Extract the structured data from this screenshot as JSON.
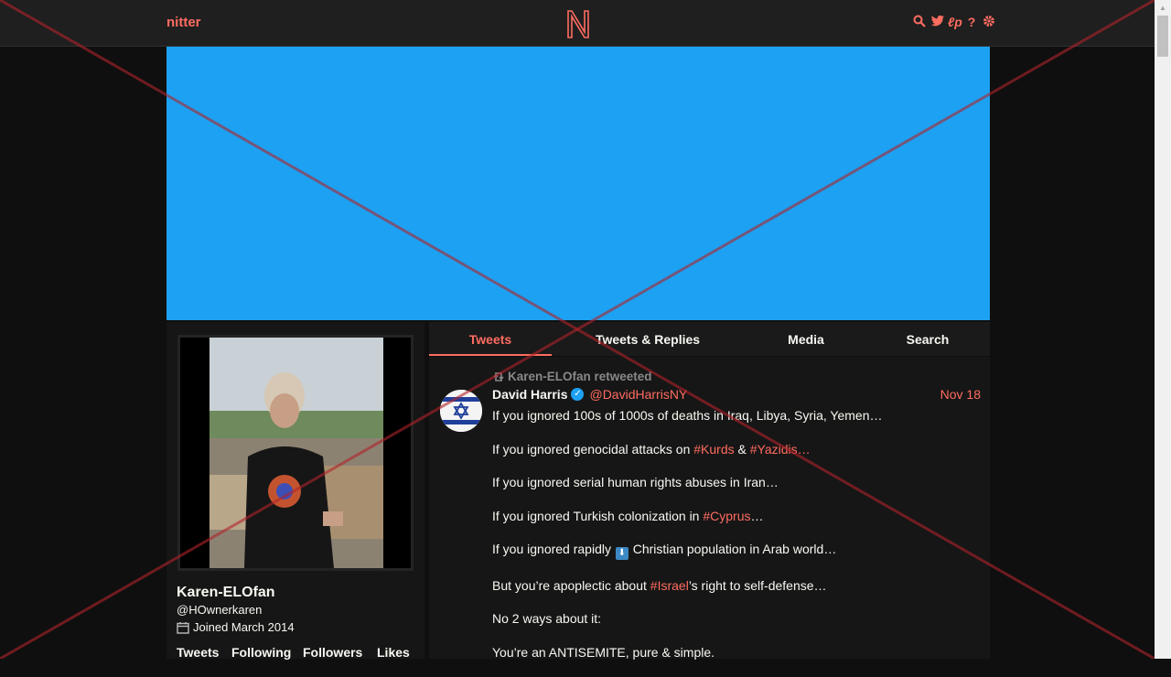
{
  "nav": {
    "brand": "nitter",
    "logo_letter": "N",
    "icons": [
      "search-icon",
      "twitter-icon",
      "rss-icon",
      "help-icon",
      "settings-icon"
    ]
  },
  "profile": {
    "name": "Karen-ELOfan",
    "handle": "@HOwnerkaren",
    "joined": "Joined March 2014",
    "stats": [
      "Tweets",
      "Following",
      "Followers",
      "Likes"
    ]
  },
  "tabs": [
    {
      "label": "Tweets",
      "active": true
    },
    {
      "label": "Tweets & Replies",
      "active": false
    },
    {
      "label": "Media",
      "active": false
    },
    {
      "label": "Search",
      "active": false
    }
  ],
  "tweet": {
    "retweet_label": "Karen-ELOfan retweeted",
    "author_name": "David Harris",
    "author_handle": "@DavidHarrisNY",
    "date": "Nov 18",
    "line1": "If you ignored 100s of 1000s of deaths in Iraq, Libya, Syria, Yemen…",
    "line2_pre": "If you ignored genocidal attacks on ",
    "line2_tag1": "#Kurds",
    "line2_mid": " & ",
    "line2_tag2": "#Yazidis",
    "line2_post": "…",
    "line3": "If you ignored serial human rights abuses in Iran…",
    "line4_pre": "If you ignored Turkish colonization in ",
    "line4_tag": "#Cyprus",
    "line4_post": "…",
    "line5_pre": "If you ignored rapidly ",
    "line5_emoji": "⬇",
    "line5_post": " Christian population in Arab world…",
    "line6_pre": "But you’re apoplectic about ",
    "line6_tag": "#Israel",
    "line6_post": "’s right to self-defense…",
    "line7": "No 2 ways about it:",
    "line8": "You’re an ANTISEMITE, pure & simple."
  },
  "colors": {
    "accent": "#ff6c60",
    "banner": "#1da1f2",
    "background": "#0f0f0f",
    "panel": "#161616",
    "navbar": "#1f1f1f",
    "overlay_x": "#b0232a"
  }
}
